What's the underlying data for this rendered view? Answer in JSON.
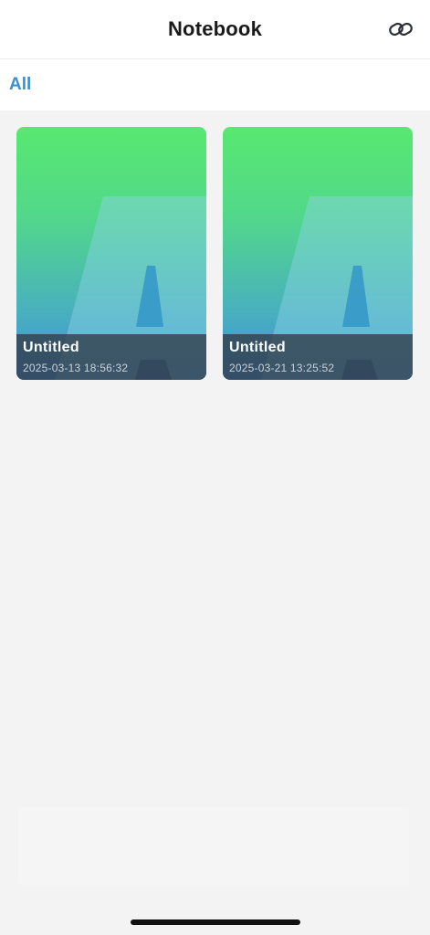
{
  "header": {
    "title": "Notebook",
    "link_icon": "link-icon"
  },
  "filter": {
    "tab_all": "All"
  },
  "notebooks": [
    {
      "title": "Untitled",
      "date": "2025-03-13 18:56:32"
    },
    {
      "title": "Untitled",
      "date": "2025-03-21 13:25:52"
    }
  ],
  "colors": {
    "accent": "#3a8fd0",
    "cover_gradient_top": "#58e870",
    "cover_gradient_bottom": "#3e8dd8"
  }
}
